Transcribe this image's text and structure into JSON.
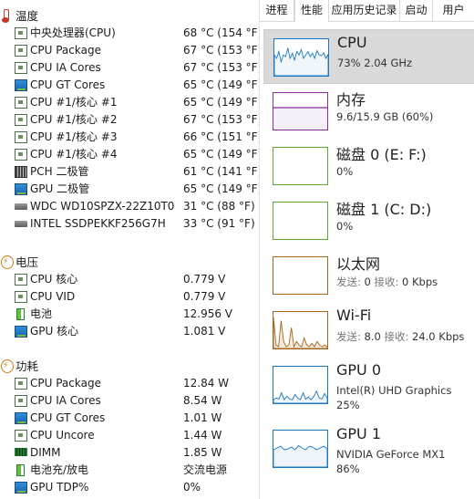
{
  "left": {
    "sections": [
      {
        "id": "temp",
        "title": "温度",
        "rows": [
          {
            "icon": "chip",
            "label": "中央处理器(CPU)",
            "value": "68 °C  (154 °F)"
          },
          {
            "icon": "chip",
            "label": "CPU Package",
            "value": "67 °C  (153 °F)"
          },
          {
            "icon": "chip",
            "label": "CPU IA Cores",
            "value": "67 °C  (153 °F)"
          },
          {
            "icon": "gpu",
            "label": "CPU GT Cores",
            "value": "65 °C  (149 °F)"
          },
          {
            "icon": "chip",
            "label": "CPU #1/核心 #1",
            "value": "65 °C  (149 °F)"
          },
          {
            "icon": "chip",
            "label": "CPU #1/核心 #2",
            "value": "67 °C  (153 °F)"
          },
          {
            "icon": "chip",
            "label": "CPU #1/核心 #3",
            "value": "66 °C  (151 °F)"
          },
          {
            "icon": "chip",
            "label": "CPU #1/核心 #4",
            "value": "65 °C  (149 °F)"
          },
          {
            "icon": "pch",
            "label": "PCH 二极管",
            "value": "61 °C  (141 °F)"
          },
          {
            "icon": "gpu",
            "label": "GPU 二极管",
            "value": "65 °C  (149 °F)"
          },
          {
            "icon": "hdd",
            "label": "WDC WD10SPZX-22Z10T0",
            "value": "31 °C  (88 °F)"
          },
          {
            "icon": "hdd",
            "label": "INTEL SSDPEKKF256G7H",
            "value": "33 °C  (91 °F)"
          }
        ]
      },
      {
        "id": "volt",
        "title": "电压",
        "rows": [
          {
            "icon": "chip",
            "label": "CPU 核心",
            "value": "0.779 V"
          },
          {
            "icon": "chip",
            "label": "CPU VID",
            "value": "0.779 V"
          },
          {
            "icon": "bat",
            "label": "电池",
            "value": "12.956 V"
          },
          {
            "icon": "gpu",
            "label": "GPU 核心",
            "value": "1.081 V"
          }
        ]
      },
      {
        "id": "power",
        "title": "功耗",
        "rows": [
          {
            "icon": "chip",
            "label": "CPU Package",
            "value": "12.84 W"
          },
          {
            "icon": "chip",
            "label": "CPU IA Cores",
            "value": "8.54 W"
          },
          {
            "icon": "gpu",
            "label": "CPU GT Cores",
            "value": "1.01 W"
          },
          {
            "icon": "chip",
            "label": "CPU Uncore",
            "value": "1.44 W"
          },
          {
            "icon": "dimm",
            "label": "DIMM",
            "value": "1.85 W"
          },
          {
            "icon": "bat",
            "label": "电池充/放电",
            "value": "交流电源"
          },
          {
            "icon": "gpu",
            "label": "GPU TDP%",
            "value": "0%"
          }
        ]
      }
    ]
  },
  "taskmanager": {
    "tabs": [
      "进程",
      "性能",
      "应用历史记录",
      "启动",
      "用户"
    ],
    "active_tab": "性能",
    "items": [
      {
        "name": "CPU",
        "line1": "73%  2.04 GHz",
        "line2": "",
        "color": "#1a78c2",
        "fill": "#f1f6fb",
        "graph": "cpu"
      },
      {
        "name": "内存",
        "line1": "9.6/15.9 GB (60%)",
        "line2": "",
        "color": "#8b2c9e",
        "fill": "#f4eef6",
        "graph": "mem"
      },
      {
        "name": "磁盘 0 (E: F:)",
        "line1": "0%",
        "line2": "",
        "color": "#5fa62c",
        "fill": "#ffffff",
        "graph": "flat"
      },
      {
        "name": "磁盘 1 (C: D:)",
        "line1": "0%",
        "line2": "",
        "color": "#5fa62c",
        "fill": "#ffffff",
        "graph": "flat"
      },
      {
        "name": "以太网",
        "line1_parts": [
          "发送: ",
          "0 ",
          "接收: ",
          "0 Kbps"
        ],
        "line2": "",
        "color": "#a7651b",
        "fill": "#ffffff",
        "graph": "flat"
      },
      {
        "name": "Wi-Fi",
        "line1_parts": [
          "发送: ",
          "8.0 ",
          "接收: ",
          "24.0 Kbps"
        ],
        "line2": "",
        "color": "#a7651b",
        "fill": "#f5eadf",
        "graph": "wifi"
      },
      {
        "name": "GPU 0",
        "line1": "Intel(R) UHD Graphics",
        "line2": "25%",
        "color": "#1a78c2",
        "fill": "#f1f6fb",
        "graph": "gpu0"
      },
      {
        "name": "GPU 1",
        "line1": "NVIDIA GeForce MX1",
        "line2": "86%",
        "color": "#1a78c2",
        "fill": "#eef4fa",
        "graph": "gpu1"
      }
    ]
  }
}
